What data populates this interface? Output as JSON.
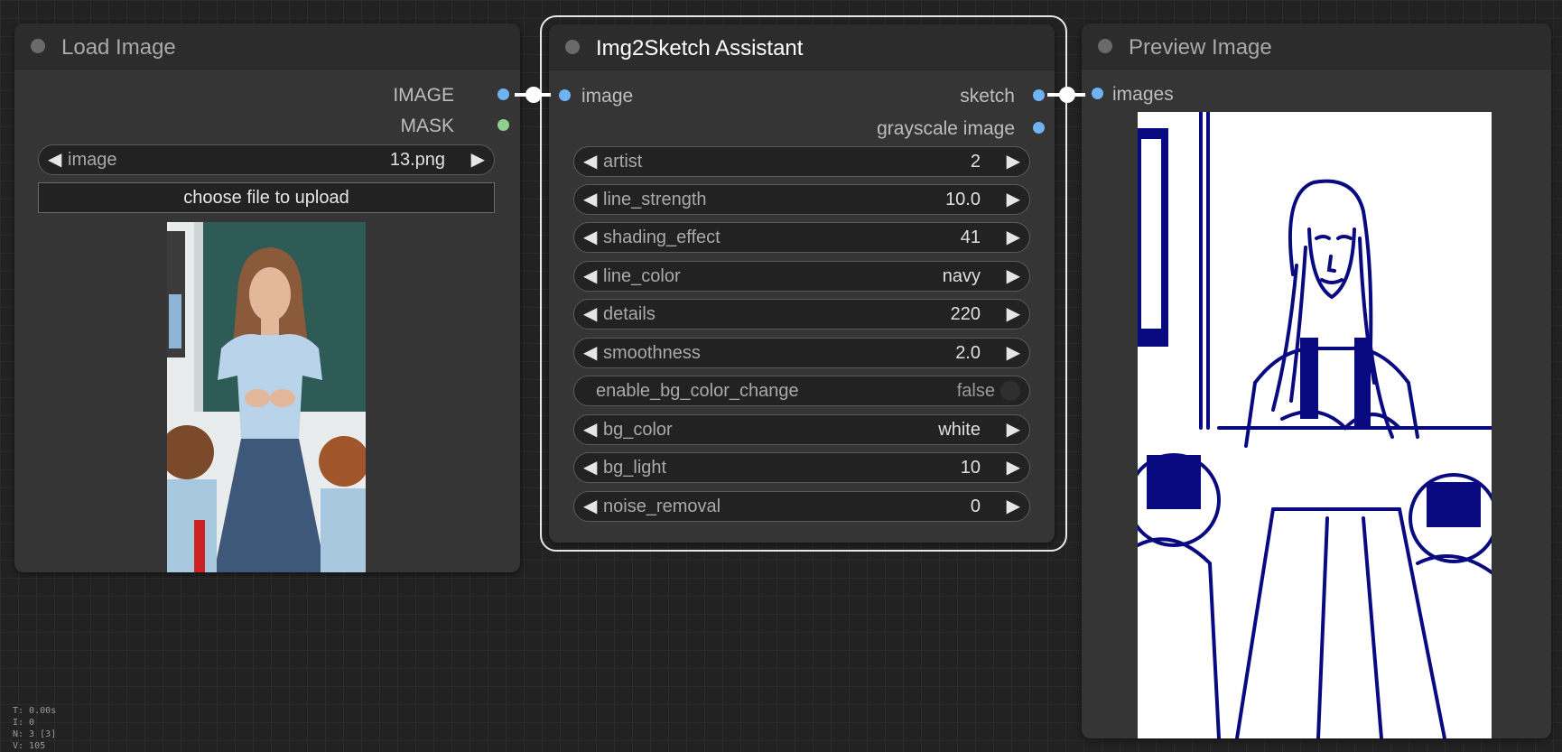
{
  "load_image": {
    "title": "Load Image",
    "outputs": [
      "IMAGE",
      "MASK"
    ],
    "image_widget": {
      "name": "image",
      "value": "13.png"
    },
    "upload_label": "choose file to upload"
  },
  "sketch": {
    "title": "Img2Sketch Assistant",
    "input": "image",
    "outputs": [
      "sketch",
      "grayscale image"
    ],
    "widgets": [
      {
        "name": "artist",
        "value": "2"
      },
      {
        "name": "line_strength",
        "value": "10.0"
      },
      {
        "name": "shading_effect",
        "value": "41"
      },
      {
        "name": "line_color",
        "value": "navy"
      },
      {
        "name": "details",
        "value": "220"
      },
      {
        "name": "smoothness",
        "value": "2.0"
      },
      {
        "name": "enable_bg_color_change",
        "value": "false"
      },
      {
        "name": "bg_color",
        "value": "white"
      },
      {
        "name": "bg_light",
        "value": "10"
      },
      {
        "name": "noise_removal",
        "value": "0"
      }
    ]
  },
  "preview": {
    "title": "Preview Image",
    "input": "images"
  },
  "stats": {
    "t": "T: 0.00s",
    "i": "I: 0",
    "n": "N: 3 [3]",
    "v": "V: 105"
  },
  "colors": {
    "canvas_bg": "#222222",
    "node_bg": "#353535",
    "link": "#ffffff",
    "slot_image": "#6fb3f2",
    "slot_mask": "#8ed08e",
    "sketch_line": "#0a0a80"
  }
}
